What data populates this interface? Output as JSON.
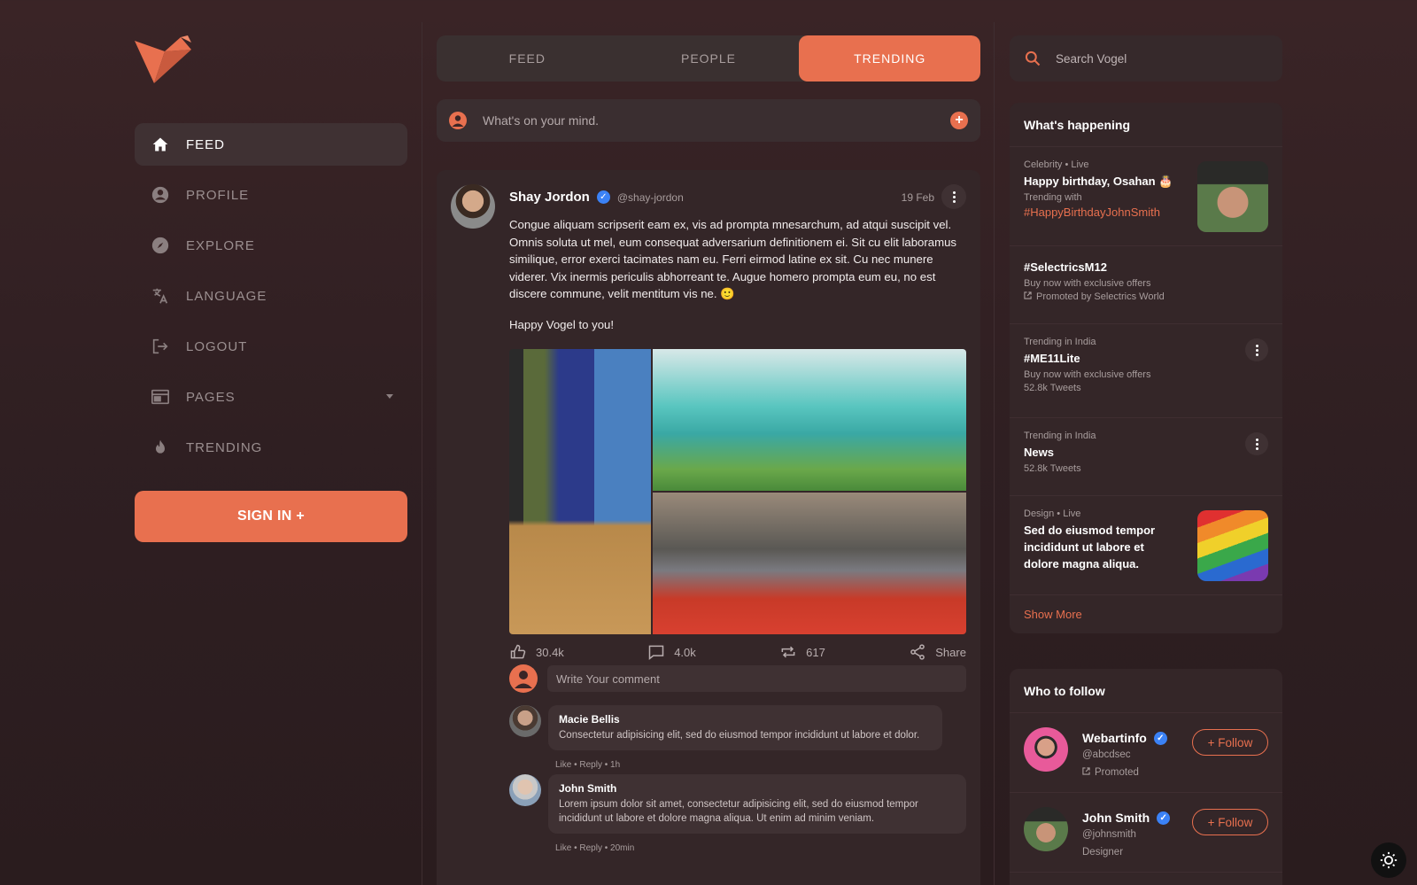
{
  "brand": {
    "logo": "vogel-bird-logo",
    "accent": "#e8704f"
  },
  "nav": {
    "items": [
      {
        "label": "FEED",
        "icon": "home-icon",
        "active": true
      },
      {
        "label": "PROFILE",
        "icon": "user-circle-icon"
      },
      {
        "label": "EXPLORE",
        "icon": "compass-icon"
      },
      {
        "label": "LANGUAGE",
        "icon": "translate-icon"
      },
      {
        "label": "LOGOUT",
        "icon": "logout-icon"
      },
      {
        "label": "PAGES",
        "icon": "pages-icon",
        "has_dropdown": true
      },
      {
        "label": "TRENDING",
        "icon": "fire-icon"
      }
    ],
    "signin_label": "SIGN IN +"
  },
  "tabs": [
    {
      "label": "FEED"
    },
    {
      "label": "PEOPLE"
    },
    {
      "label": "TRENDING",
      "active": true
    }
  ],
  "composer": {
    "placeholder": "What's on your mind."
  },
  "post": {
    "author": "Shay Jordon",
    "handle": "@shay-jordon",
    "date": "19 Feb",
    "body": "Congue aliquam scripserit eam ex, vis ad prompta mnesarchum, ad atqui suscipit vel. Omnis soluta ut mel, eum consequat adversarium definitionem ei. Sit cu elit laboramus similique, error exerci tacimates nam eu. Ferri eirmod latine ex sit. Cu nec munere viderer. Vix inermis periculis abhorreant te. Augue homero prompta eum eu, no est discere commune, velit mentitum vis ne. 🙂",
    "body2": "Happy Vogel to you!",
    "likes": "30.4k",
    "comments": "4.0k",
    "reposts": "617",
    "share_label": "Share",
    "comment_placeholder": "Write Your comment",
    "replies": [
      {
        "name": "Macie Bellis",
        "text": "Consectetur adipisicing elit, sed do eiusmod tempor incididunt ut labore et dolor.",
        "meta": "Like • Reply • 1h"
      },
      {
        "name": "John Smith",
        "text": "Lorem ipsum dolor sit amet, consectetur adipisicing elit, sed do eiusmod tempor incididunt ut labore et dolore magna aliqua. Ut enim ad minim veniam.",
        "meta": "Like • Reply • 20min"
      }
    ]
  },
  "search": {
    "placeholder": "Search Vogel"
  },
  "happening": {
    "title": "What's happening",
    "items": [
      {
        "category": "Celebrity • Live",
        "title": "Happy birthday, Osahan 🎂",
        "sub": "Trending with",
        "hashtag": "#HappyBirthdayJohnSmith"
      },
      {
        "title": "#SelectricsM12",
        "sub": "Buy now with exclusive offers",
        "promo": "Promoted by Selectrics World"
      },
      {
        "category": "Trending in India",
        "title": "#ME11Lite",
        "sub": "Buy now with exclusive offers",
        "count": "52.8k Tweets"
      },
      {
        "category": "Trending in India",
        "title": "News",
        "count": "52.8k Tweets"
      },
      {
        "category": "Design • Live",
        "title": "Sed do eiusmod tempor incididunt ut labore et dolore magna aliqua."
      }
    ],
    "show_more": "Show More"
  },
  "who_to_follow": {
    "title": "Who to follow",
    "users": [
      {
        "name": "Webartinfo",
        "handle": "@abcdsec",
        "extra": "Promoted",
        "button": "+ Follow"
      },
      {
        "name": "John Smith",
        "handle": "@johnsmith",
        "extra": "Designer",
        "button": "+ Follow"
      }
    ]
  }
}
